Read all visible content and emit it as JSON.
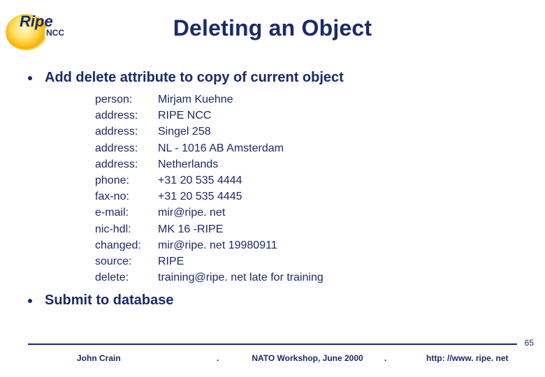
{
  "logo": {
    "main": "Ripe",
    "sub": "NCC"
  },
  "title": "Deleting an Object",
  "bullets": {
    "b1": "Add delete attribute to copy of current object",
    "b2": "Submit to database"
  },
  "attrs": [
    {
      "key": "person:",
      "val": "Mirjam Kuehne"
    },
    {
      "key": "address:",
      "val": "RIPE NCC"
    },
    {
      "key": "address:",
      "val": "Singel 258"
    },
    {
      "key": "address:",
      "val": "NL - 1016 AB Amsterdam"
    },
    {
      "key": "address:",
      "val": "Netherlands"
    },
    {
      "key": "phone:",
      "val": "+31 20 535 4444"
    },
    {
      "key": "fax-no:",
      "val": "+31 20 535 4445"
    },
    {
      "key": "e-mail:",
      "val": "mir@ripe. net"
    },
    {
      "key": "nic-hdl:",
      "val": "MK 16 -RIPE"
    },
    {
      "key": "changed:",
      "val": "mir@ripe. net 19980911"
    },
    {
      "key": "source:",
      "val": "RIPE"
    },
    {
      "key": "delete:",
      "val": "training@ripe. net late for training"
    }
  ],
  "footer": {
    "author": "John Crain",
    "event": "NATO Workshop, June 2000",
    "url": "http: //www. ripe. net",
    "dot": "."
  },
  "page_number": "65"
}
